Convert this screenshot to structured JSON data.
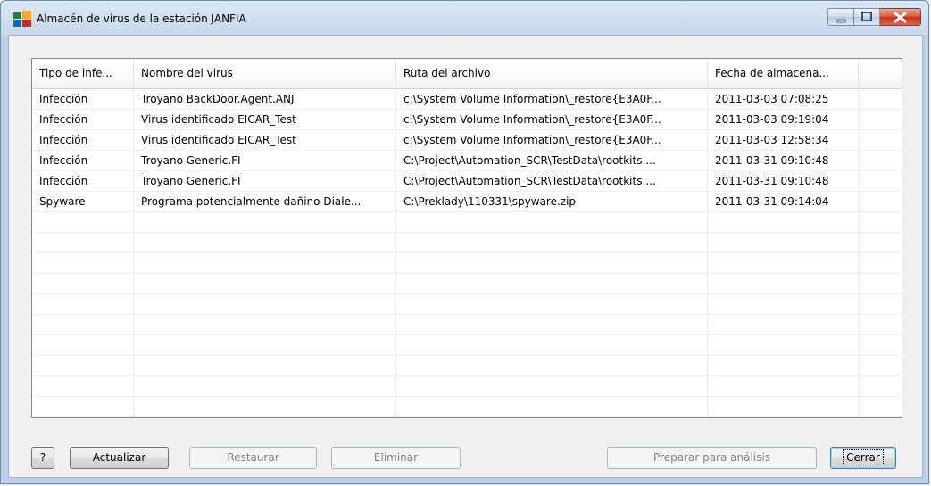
{
  "window": {
    "title": "Almacén de virus de la estación JANFIA",
    "icon": "avg-logo-icon"
  },
  "listview": {
    "columns": [
      "Tipo de infe...",
      "Nombre del virus",
      "Ruta del archivo",
      "Fecha de almacena..."
    ],
    "rows": [
      [
        "Infección",
        "Troyano BackDoor.Agent.ANJ",
        "c:\\System Volume Information\\_restore{E3A0F...",
        "2011-03-03 07:08:25"
      ],
      [
        "Infección",
        "Virus identificado EICAR_Test",
        "c:\\System Volume Information\\_restore{E3A0F...",
        "2011-03-03 09:19:04"
      ],
      [
        "Infección",
        "Virus identificado EICAR_Test",
        "c:\\System Volume Information\\_restore{E3A0F...",
        "2011-03-03 12:58:34"
      ],
      [
        "Infección",
        "Troyano Generic.FI",
        "C:\\Project\\Automation_SCR\\TestData\\rootkits....",
        "2011-03-31 09:10:48"
      ],
      [
        "Infección",
        "Troyano Generic.FI",
        "C:\\Project\\Automation_SCR\\TestData\\rootkits....",
        "2011-03-31 09:10:48"
      ],
      [
        "Spyware",
        "Programa potencialmente dañino Diale...",
        "C:\\Preklady\\110331\\spyware.zip",
        "2011-03-31 09:14:04"
      ]
    ]
  },
  "buttons": {
    "help": "?",
    "refresh": "Actualizar",
    "restore": "Restaurar",
    "delete": "Eliminar",
    "prepare": "Preparar para análisis",
    "close": "Cerrar"
  }
}
